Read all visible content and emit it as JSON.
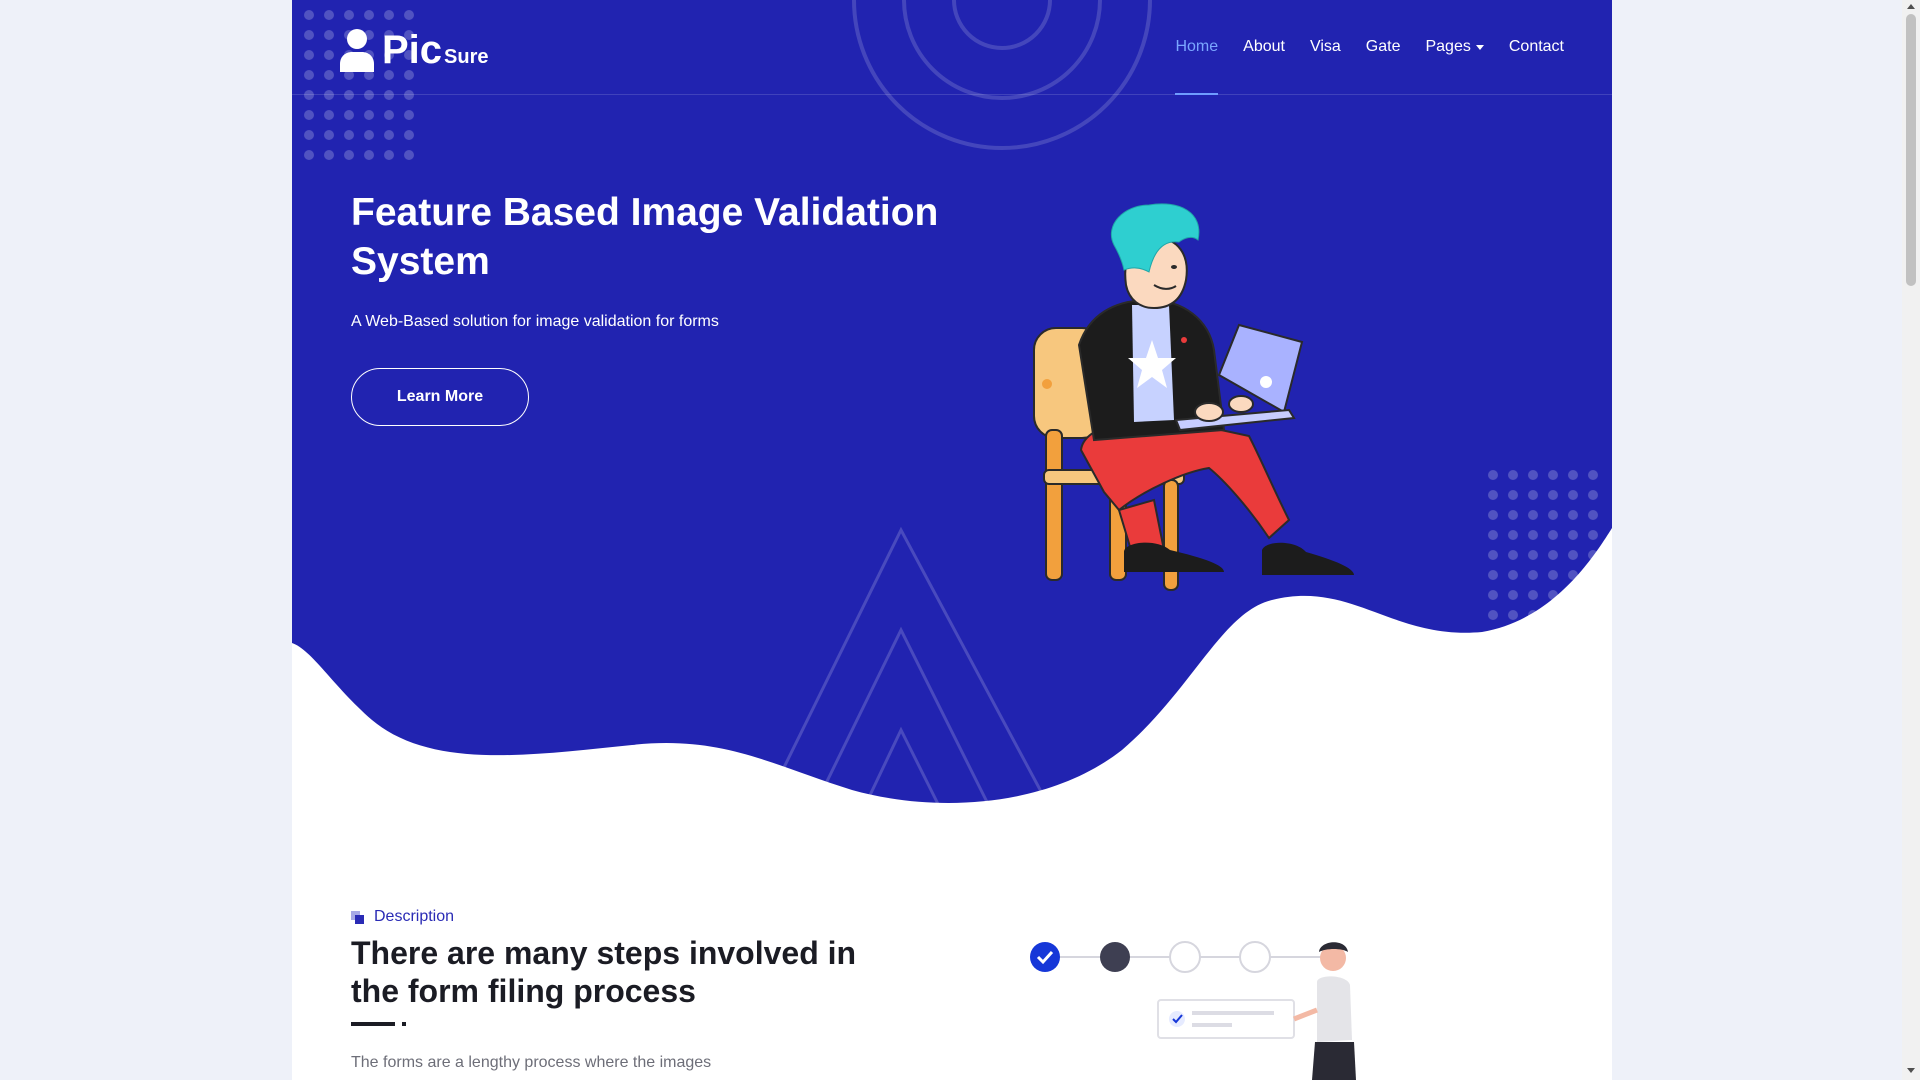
{
  "brand": {
    "main": "Pic",
    "sub": "Sure"
  },
  "nav": {
    "items": [
      {
        "label": "Home",
        "active": true
      },
      {
        "label": "About"
      },
      {
        "label": "Visa"
      },
      {
        "label": "Gate"
      },
      {
        "label": "Pages",
        "dropdown": true
      },
      {
        "label": "Contact"
      }
    ]
  },
  "hero": {
    "title": "Feature Based Image Validation System",
    "subtitle": "A Web-Based solution for image validation for forms",
    "cta_label": "Learn More"
  },
  "description": {
    "tag": "Description",
    "heading": "There are many steps involved in the form filing process",
    "text": "The forms are a lengthy process where the images"
  },
  "colors": {
    "hero_bg": "#2123b0",
    "accent": "#7aa6ff",
    "check_blue": "#1637d8",
    "dark_step": "#3e3f52"
  }
}
